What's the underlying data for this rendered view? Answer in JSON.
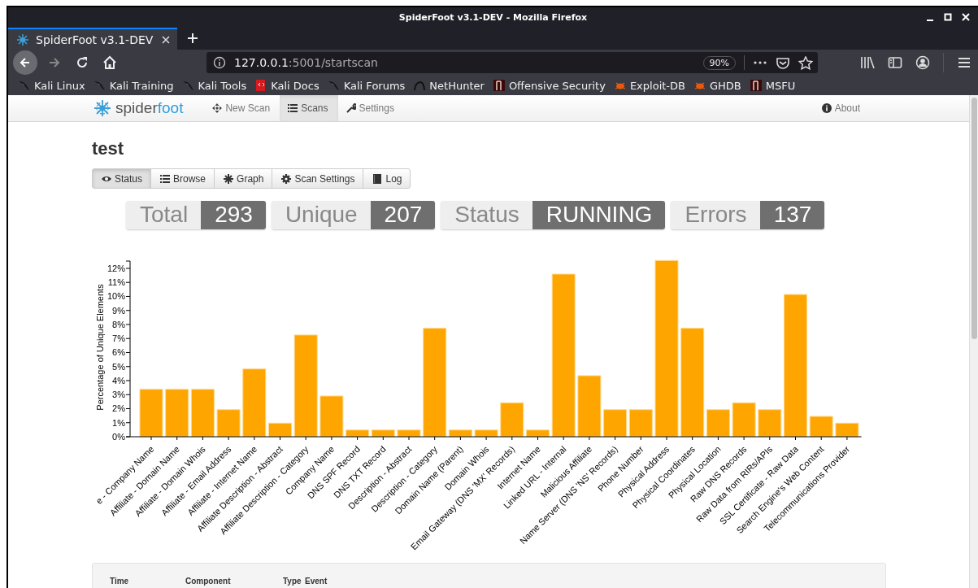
{
  "window": {
    "title": "SpiderFoot v3.1-DEV - Mozilla Firefox"
  },
  "browser_tabs": [
    {
      "label": "SpiderFoot v3.1-DEV",
      "selected": true
    }
  ],
  "address_bar": {
    "host": "127.0.0.1",
    "path": ":5001/startscan",
    "zoom": "90%"
  },
  "bookmarks": [
    {
      "label": "Kali Linux",
      "kind": "kali"
    },
    {
      "label": "Kali Training",
      "kind": "kali"
    },
    {
      "label": "Kali Tools",
      "kind": "kali"
    },
    {
      "label": "Kali Docs",
      "kind": "docs"
    },
    {
      "label": "Kali Forums",
      "kind": "kali"
    },
    {
      "label": "NetHunter",
      "kind": "nethunter"
    },
    {
      "label": "Offensive Security",
      "kind": "offsec"
    },
    {
      "label": "Exploit-DB",
      "kind": "bug"
    },
    {
      "label": "GHDB",
      "kind": "bug"
    },
    {
      "label": "MSFU",
      "kind": "offsec"
    }
  ],
  "navbar": {
    "brand_first": "spider",
    "brand_second": "foot",
    "items": [
      {
        "label": "New Scan",
        "selected": false
      },
      {
        "label": "Scans",
        "selected": true
      },
      {
        "label": "Settings",
        "selected": false
      }
    ],
    "about": "About"
  },
  "scan_title": "test",
  "scan_tabs": [
    {
      "label": "Status",
      "selected": true
    },
    {
      "label": "Browse",
      "selected": false
    },
    {
      "label": "Graph",
      "selected": false
    },
    {
      "label": "Scan Settings",
      "selected": false
    },
    {
      "label": "Log",
      "selected": false
    }
  ],
  "stats": [
    {
      "label": "Total",
      "value": "293"
    },
    {
      "label": "Unique",
      "value": "207"
    },
    {
      "label": "Status",
      "value": "RUNNING"
    },
    {
      "label": "Errors",
      "value": "137"
    }
  ],
  "chart": {
    "chart_data": {
      "type": "bar",
      "ylabel": "Percentage of Unique Elements",
      "categories": [
        "e - Company Name",
        "Affiliate - Domain Name",
        "Affiliate - Domain Whois",
        "Affiliate - Email Address",
        "Affiliate - Internet Name",
        "Affiliate Description - Abstract",
        "Affiliate Description - Category",
        "Company Name",
        "DNS SPF Record",
        "DNS TXT Record",
        "Description - Abstract",
        "Description - Category",
        "Domain Name (Parent)",
        "Domain Whois",
        "Email Gateway (DNS 'MX' Records)",
        "Internet Name",
        "Linked URL - Internal",
        "Malicious Affiliate",
        "Name Server (DNS 'NS' Records)",
        "Phone Number",
        "Physical Address",
        "Physical Coordinates",
        "Physical Location",
        "Raw DNS Records",
        "Raw Data from RIRs/APIs",
        "SSL Certificate - Raw Data",
        "Search Engine's Web Content",
        "Telecommunications Provider"
      ],
      "series": [
        {
          "color": "#ffa500",
          "values": [
            3.38,
            3.38,
            3.38,
            1.93,
            4.83,
            0.97,
            7.25,
            2.9,
            0.48,
            0.48,
            0.48,
            7.73,
            0.48,
            0.48,
            2.42,
            0.48,
            11.59,
            4.35,
            1.93,
            1.93,
            12.56,
            7.73,
            1.93,
            2.42,
            1.93,
            10.14,
            1.45,
            0.97
          ]
        }
      ],
      "ylim": [
        0,
        12.56
      ],
      "yticks": [
        {
          "value": 0,
          "label": "0%"
        },
        {
          "value": 1,
          "label": "1%"
        },
        {
          "value": 2,
          "label": "2%"
        },
        {
          "value": 3,
          "label": "3%"
        },
        {
          "value": 4,
          "label": "4%"
        },
        {
          "value": 5,
          "label": "5%"
        },
        {
          "value": 6,
          "label": "6%"
        },
        {
          "value": 7,
          "label": "7%"
        },
        {
          "value": 8,
          "label": "8%"
        },
        {
          "value": 9,
          "label": "9%"
        },
        {
          "value": 10,
          "label": "10%"
        },
        {
          "value": 11,
          "label": "11%"
        },
        {
          "value": 12,
          "label": "12%"
        }
      ]
    }
  },
  "log_table": {
    "columns": [
      "Time",
      "Component",
      "Type",
      "Event"
    ]
  }
}
